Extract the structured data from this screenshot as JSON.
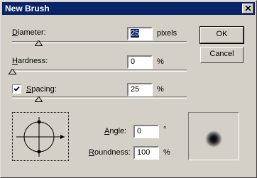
{
  "window": {
    "title": "New Brush"
  },
  "diameter": {
    "label": "Diameter:",
    "value": "25",
    "unit": "pixels",
    "slider_fraction": 0.15
  },
  "hardness": {
    "label": "Hardness:",
    "value": "0",
    "unit": "%",
    "slider_fraction": 0.0
  },
  "spacing": {
    "label": "Spacing:",
    "value": "25",
    "unit": "%",
    "checked": true,
    "slider_fraction": 0.15
  },
  "angle": {
    "label": "Angle:",
    "value": "0",
    "unit": "°"
  },
  "roundness": {
    "label": "Roundness:",
    "value": "100",
    "unit": "%"
  },
  "buttons": {
    "ok": "OK",
    "cancel": "Cancel"
  }
}
